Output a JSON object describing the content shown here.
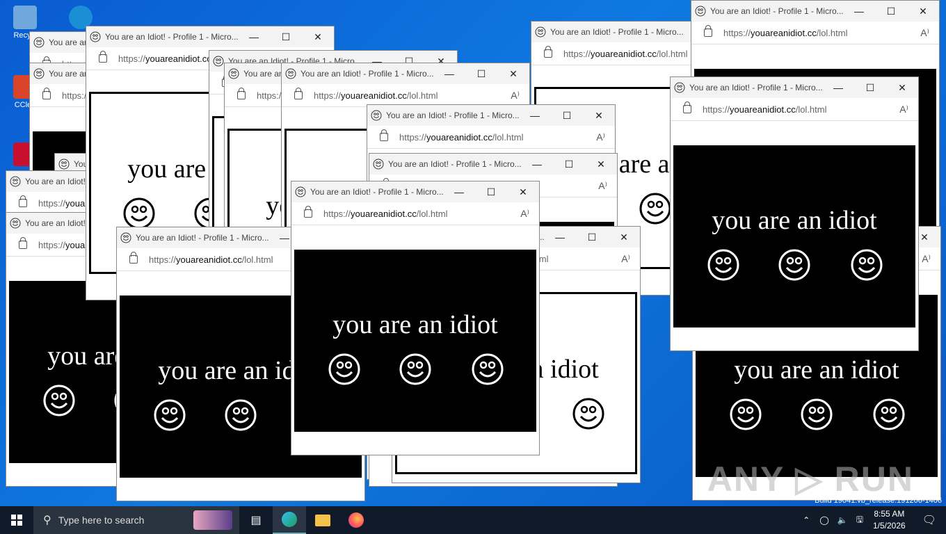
{
  "desktop": {
    "icons": [
      {
        "label": "Recycl",
        "color": "#6fa8dc"
      },
      {
        "label": "",
        "color": "#1a8fd6"
      },
      {
        "label": "CClea",
        "color": "#d9442a"
      },
      {
        "label": "",
        "color": "#c8102e"
      }
    ]
  },
  "window": {
    "title": "You are an Idiot! - Profile 1 - Micro...",
    "url_prefix": "https://",
    "url_domain": "youareanidiot.cc",
    "url_path": "/lol.html",
    "read_aloud": "A⁾",
    "minimize": "—",
    "maximize": "☐",
    "close": "✕"
  },
  "page": {
    "message": "you are an idiot"
  },
  "taskbar": {
    "search_placeholder": "Type here to search",
    "time": "8:55 AM",
    "date": "1/5/2026"
  },
  "watermark": "ANY ▷ RUN",
  "build": "Build 19041.vb_release.191206-1406"
}
